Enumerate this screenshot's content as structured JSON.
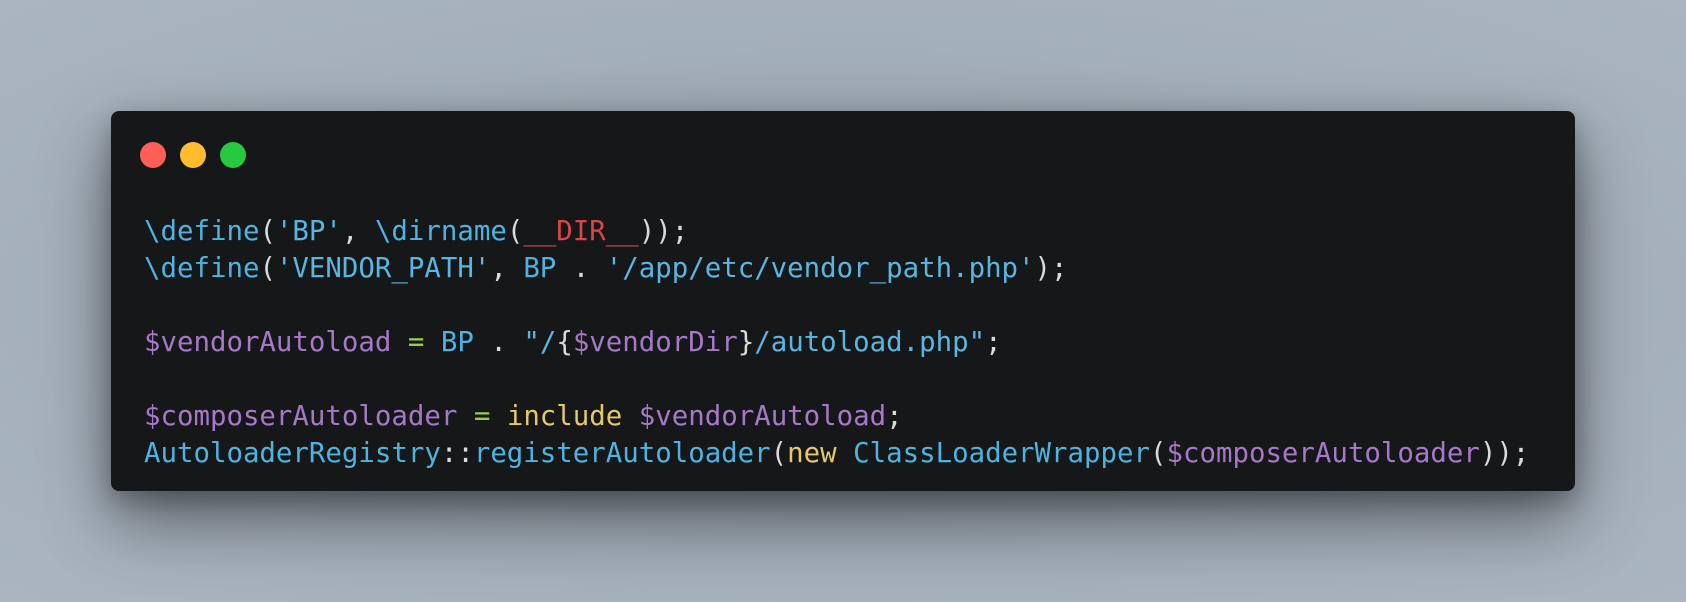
{
  "window": {
    "controls": {
      "close_color": "#ff5f56",
      "minimize_color": "#ffbd2e",
      "maximize_color": "#27c93f"
    }
  },
  "code": {
    "language": "php",
    "lines": [
      [
        {
          "text": "\\define",
          "kind": "blue"
        },
        {
          "text": "(",
          "kind": "plain"
        },
        {
          "text": "'BP'",
          "kind": "str"
        },
        {
          "text": ", ",
          "kind": "plain"
        },
        {
          "text": "\\dirname",
          "kind": "blue"
        },
        {
          "text": "(",
          "kind": "plain"
        },
        {
          "text": "__DIR__",
          "kind": "red"
        },
        {
          "text": "));",
          "kind": "plain"
        }
      ],
      [
        {
          "text": "\\define",
          "kind": "blue"
        },
        {
          "text": "(",
          "kind": "plain"
        },
        {
          "text": "'VENDOR_PATH'",
          "kind": "str"
        },
        {
          "text": ", ",
          "kind": "plain"
        },
        {
          "text": "BP",
          "kind": "blue"
        },
        {
          "text": " . ",
          "kind": "plain"
        },
        {
          "text": "'/app/etc/vendor_path.php'",
          "kind": "str"
        },
        {
          "text": ");",
          "kind": "plain"
        }
      ],
      [],
      [
        {
          "text": "$vendorAutoload",
          "kind": "purple"
        },
        {
          "text": " ",
          "kind": "plain"
        },
        {
          "text": "=",
          "kind": "green"
        },
        {
          "text": " ",
          "kind": "plain"
        },
        {
          "text": "BP",
          "kind": "blue"
        },
        {
          "text": " . ",
          "kind": "plain"
        },
        {
          "text": "\"/",
          "kind": "str"
        },
        {
          "text": "{",
          "kind": "plain"
        },
        {
          "text": "$vendorDir",
          "kind": "purple"
        },
        {
          "text": "}",
          "kind": "plain"
        },
        {
          "text": "/autoload.php\"",
          "kind": "str"
        },
        {
          "text": ";",
          "kind": "plain"
        }
      ],
      [],
      [
        {
          "text": "$composerAutoloader",
          "kind": "purple"
        },
        {
          "text": " ",
          "kind": "plain"
        },
        {
          "text": "=",
          "kind": "green"
        },
        {
          "text": " ",
          "kind": "plain"
        },
        {
          "text": "include",
          "kind": "yellow"
        },
        {
          "text": " ",
          "kind": "plain"
        },
        {
          "text": "$vendorAutoload",
          "kind": "purple"
        },
        {
          "text": ";",
          "kind": "plain"
        }
      ],
      [
        {
          "text": "AutoloaderRegistry",
          "kind": "blue"
        },
        {
          "text": "::",
          "kind": "plain"
        },
        {
          "text": "registerAutoloader",
          "kind": "blue"
        },
        {
          "text": "(",
          "kind": "plain"
        },
        {
          "text": "new",
          "kind": "yellow"
        },
        {
          "text": " ",
          "kind": "plain"
        },
        {
          "text": "ClassLoaderWrapper",
          "kind": "blue"
        },
        {
          "text": "(",
          "kind": "plain"
        },
        {
          "text": "$composerAutoloader",
          "kind": "purple"
        },
        {
          "text": "));",
          "kind": "plain"
        }
      ]
    ]
  }
}
